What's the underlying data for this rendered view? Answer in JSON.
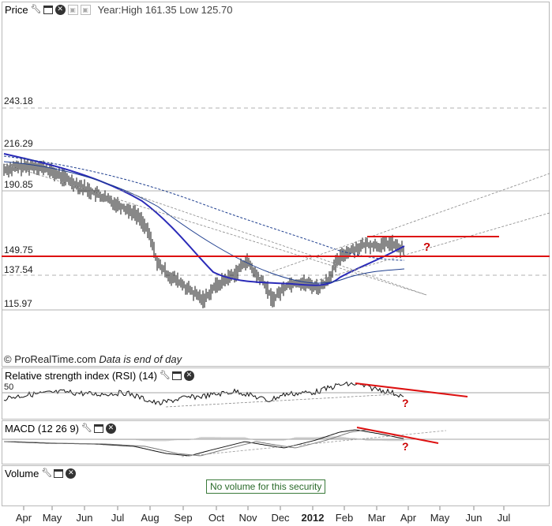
{
  "price_panel": {
    "title": "Price",
    "year_info": "Year:High 161.35 Low 125.70",
    "levels": [
      "243.18",
      "216.29",
      "190.85",
      "149.75",
      "137.54",
      "115.97"
    ],
    "watermark": "© ProRealTime.com",
    "watermark_note": "Data is end of day"
  },
  "rsi_panel": {
    "title": "Relative strength index (RSI) (14)",
    "level": "50",
    "mark": "?"
  },
  "macd_panel": {
    "title": "MACD (12 26 9)",
    "mark": "?"
  },
  "volume_panel": {
    "title": "Volume",
    "message": "No volume for this security"
  },
  "annotation_mark": "?",
  "colors": {
    "resistance": "#dd1111",
    "ma_fast": "#2222bb",
    "ma_slow": "#1a3a99",
    "trend": "#777777"
  },
  "icons": [
    "wrench-icon",
    "window-icon",
    "close-icon",
    "dock-icon",
    "undock-icon"
  ],
  "chart_data": {
    "type": "line",
    "x_ticks": [
      "Apr",
      "May",
      "Jun",
      "Jul",
      "Aug",
      "Sep",
      "Oct",
      "Nov",
      "Dec",
      "2012",
      "Feb",
      "Mar",
      "Apr",
      "May",
      "Jun",
      "Jul"
    ],
    "price_levels": [
      243.18,
      216.29,
      190.85,
      149.75,
      137.54,
      115.97
    ],
    "year_high": 161.35,
    "year_low": 125.7,
    "support_level": 149.75,
    "resistance_level": 161.35
  }
}
